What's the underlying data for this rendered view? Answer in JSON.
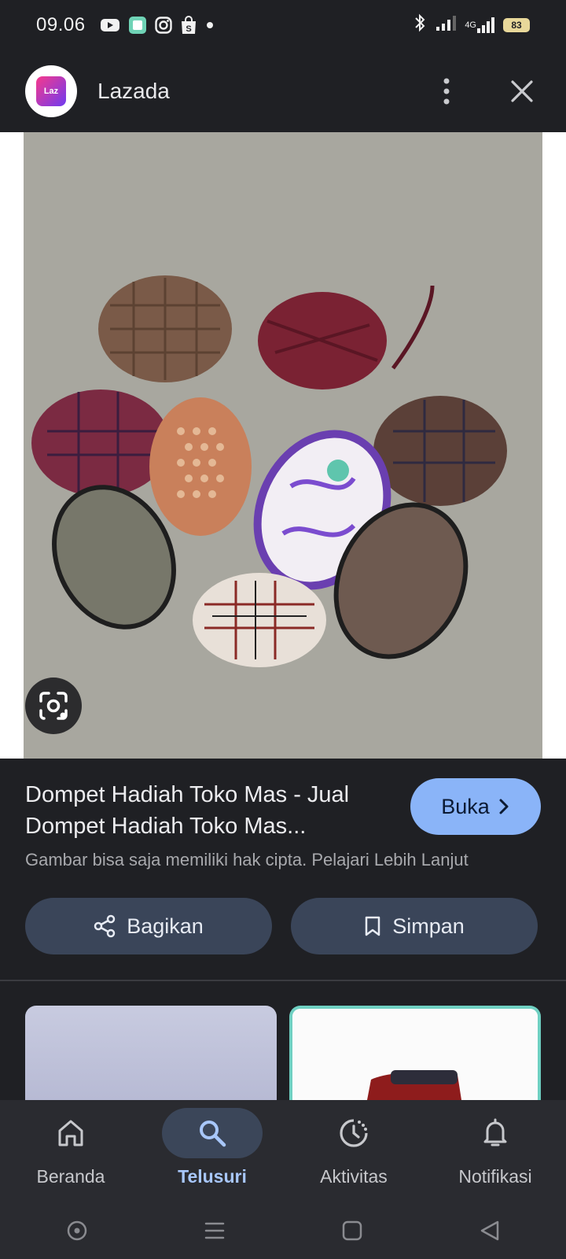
{
  "status_bar": {
    "time": "09.06",
    "battery": "83",
    "network": "4G"
  },
  "header": {
    "app_logo_text": "Laz",
    "title": "Lazada"
  },
  "result": {
    "title_line1": "Dompet Hadiah Toko Mas - Jual",
    "title_line2": "Dompet Hadiah Toko Mas...",
    "open_label": "Buka",
    "copyright": "Gambar bisa saja memiliki hak cipta. Pelajari Lebih Lanjut",
    "share_label": "Bagikan",
    "save_label": "Simpan"
  },
  "bottom_nav": {
    "items": [
      {
        "label": "Beranda",
        "icon": "home-icon"
      },
      {
        "label": "Telusuri",
        "icon": "search-icon",
        "active": true
      },
      {
        "label": "Aktivitas",
        "icon": "activity-icon"
      },
      {
        "label": "Notifikasi",
        "icon": "bell-icon"
      }
    ]
  },
  "colors": {
    "background": "#1f2024",
    "accent": "#8ab4f8",
    "button_bg": "#3a4559",
    "active_nav_text": "#a8c7fa"
  }
}
